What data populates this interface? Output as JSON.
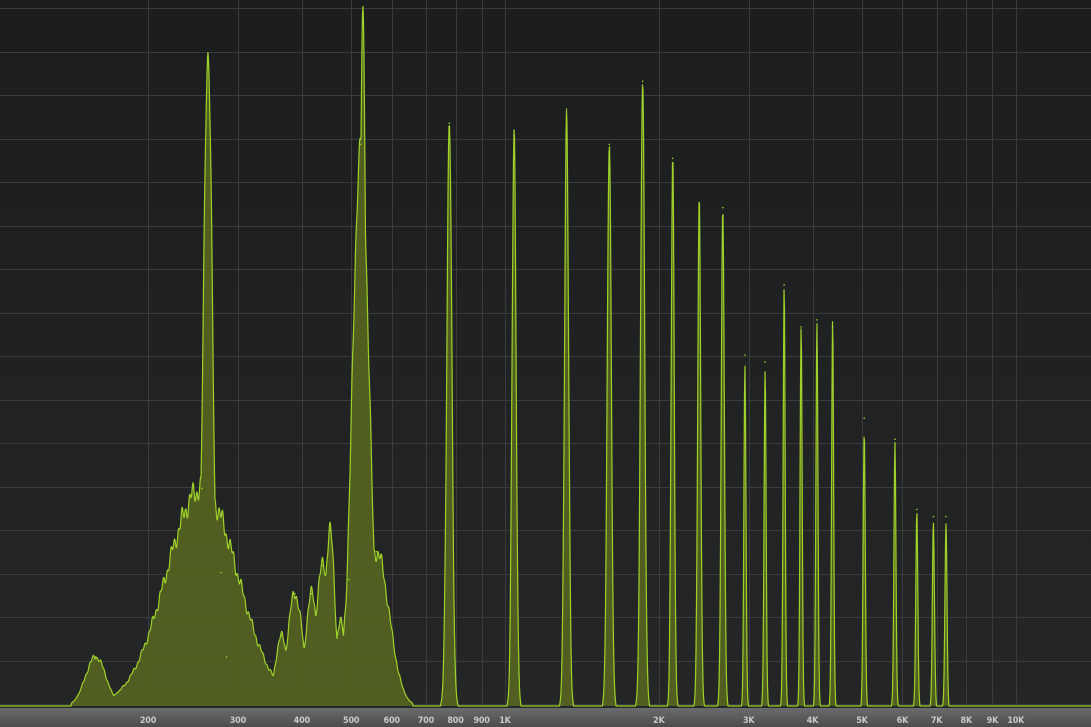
{
  "chart_data": {
    "type": "area",
    "title": "",
    "xlabel": "",
    "ylabel": "",
    "x_scale": "log",
    "xlim": [
      140,
      14000
    ],
    "ylim": [
      0,
      1
    ],
    "grid": true,
    "legend": "none",
    "x_ticks": [
      {
        "value": 200,
        "label": "200"
      },
      {
        "value": 300,
        "label": "300"
      },
      {
        "value": 400,
        "label": "400"
      },
      {
        "value": 500,
        "label": "500"
      },
      {
        "value": 600,
        "label": "600"
      },
      {
        "value": 700,
        "label": "700"
      },
      {
        "value": 800,
        "label": "800"
      },
      {
        "value": 900,
        "label": "900"
      },
      {
        "value": 1000,
        "label": "1K"
      },
      {
        "value": 2000,
        "label": "2K"
      },
      {
        "value": 3000,
        "label": "3K"
      },
      {
        "value": 4000,
        "label": "4K"
      },
      {
        "value": 5000,
        "label": "5K"
      },
      {
        "value": 6000,
        "label": "6K"
      },
      {
        "value": 7000,
        "label": "7K"
      },
      {
        "value": 8000,
        "label": "8K"
      },
      {
        "value": 9000,
        "label": "9K"
      },
      {
        "value": 10000,
        "label": "10K"
      }
    ],
    "colors": {
      "background": "#1e1f20",
      "grid": "#3a3b3c",
      "fill": "#536221",
      "stroke": "#9fd12a",
      "axis_bar": "#58595b"
    },
    "series": [
      {
        "values": [
          {
            "f": 158,
            "a": 0.07,
            "w": 0.02
          },
          {
            "f": 255,
            "a": 0.31,
            "w": 0.07
          },
          {
            "f": 262,
            "a": 0.93,
            "w": 0.009
          },
          {
            "f": 278,
            "a": 0.19,
            "w": 0.025
          },
          {
            "f": 285,
            "a": 0.07,
            "w": 0.04
          },
          {
            "f": 365,
            "a": 0.1,
            "w": 0.012
          },
          {
            "f": 388,
            "a": 0.16,
            "w": 0.015
          },
          {
            "f": 418,
            "a": 0.16,
            "w": 0.012
          },
          {
            "f": 440,
            "a": 0.2,
            "w": 0.015
          },
          {
            "f": 454,
            "a": 0.25,
            "w": 0.01
          },
          {
            "f": 476,
            "a": 0.12,
            "w": 0.01
          },
          {
            "f": 495,
            "a": 0.18,
            "w": 0.01
          },
          {
            "f": 522,
            "a": 0.8,
            "w": 0.016
          },
          {
            "f": 527,
            "a": 0.98,
            "w": 0.006
          },
          {
            "f": 560,
            "a": 0.22,
            "w": 0.025
          },
          {
            "f": 778,
            "a": 0.83,
            "w": 0.005
          },
          {
            "f": 1042,
            "a": 0.82,
            "w": 0.004
          },
          {
            "f": 1320,
            "a": 0.85,
            "w": 0.004
          },
          {
            "f": 1600,
            "a": 0.8,
            "w": 0.004
          },
          {
            "f": 1860,
            "a": 0.89,
            "w": 0.004
          },
          {
            "f": 2130,
            "a": 0.78,
            "w": 0.003
          },
          {
            "f": 2400,
            "a": 0.71,
            "w": 0.003
          },
          {
            "f": 2670,
            "a": 0.71,
            "w": 0.003
          },
          {
            "f": 2950,
            "a": 0.5,
            "w": 0.002
          },
          {
            "f": 3230,
            "a": 0.49,
            "w": 0.002
          },
          {
            "f": 3520,
            "a": 0.6,
            "w": 0.002
          },
          {
            "f": 3800,
            "a": 0.54,
            "w": 0.002
          },
          {
            "f": 4080,
            "a": 0.55,
            "w": 0.002
          },
          {
            "f": 4380,
            "a": 0.54,
            "w": 0.002
          },
          {
            "f": 5050,
            "a": 0.41,
            "w": 0.002
          },
          {
            "f": 5800,
            "a": 0.38,
            "w": 0.002
          },
          {
            "f": 6400,
            "a": 0.28,
            "w": 0.002
          },
          {
            "f": 6900,
            "a": 0.27,
            "w": 0.002
          },
          {
            "f": 7300,
            "a": 0.27,
            "w": 0.002
          }
        ]
      }
    ]
  }
}
